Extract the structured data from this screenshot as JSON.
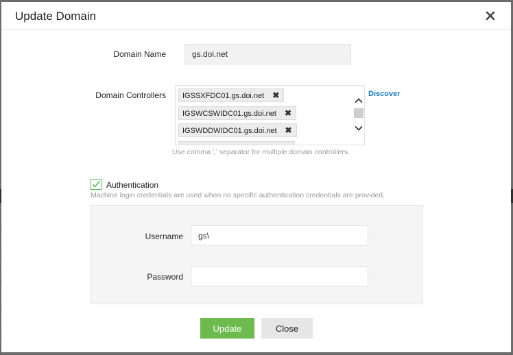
{
  "modal": {
    "title": "Update Domain",
    "close_icon": "close-icon"
  },
  "form": {
    "domain_name": {
      "label": "Domain Name",
      "value": "gs.doi.net"
    },
    "domain_controllers": {
      "label": "Domain Controllers",
      "items": [
        "IGSSXFDC01.gs.doi.net",
        "IGSWCSWIDC01.gs.doi.net",
        "IGSWDDWIDC01.gs.doi.net"
      ],
      "remove_symbol": "✖",
      "discover_label": "Discover",
      "hint": "Use comma ',' separator for multiple domain controllers."
    },
    "authentication": {
      "checked": true,
      "label": "Authentication",
      "hint": "Machine login credentials are used when no specific authentication credentials are provided.",
      "username": {
        "label": "Username",
        "value": "gs\\"
      },
      "password": {
        "label": "Password",
        "value": ""
      }
    }
  },
  "buttons": {
    "update": "Update",
    "close": "Close"
  },
  "colors": {
    "primary_button": "#6dbb4f",
    "link": "#1a7dbf",
    "checkbox": "#5cb85c"
  }
}
